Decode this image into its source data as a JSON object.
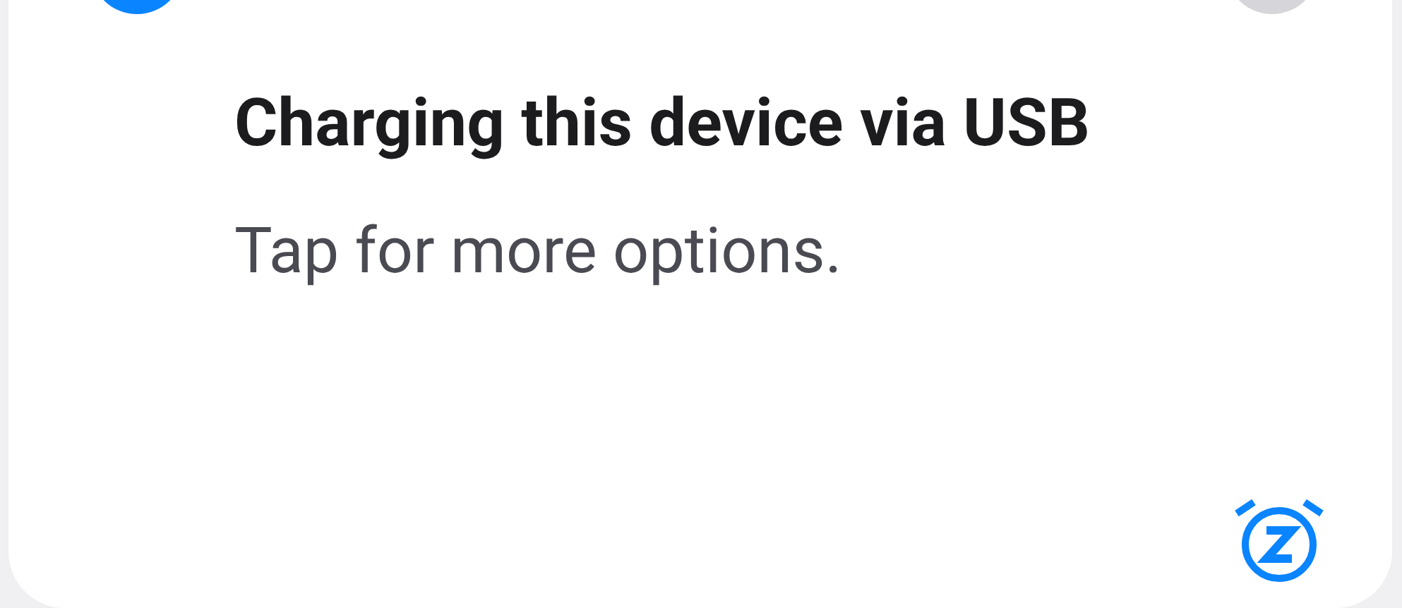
{
  "notification": {
    "title": "Charging this device via USB",
    "text": "Tap for more options."
  }
}
